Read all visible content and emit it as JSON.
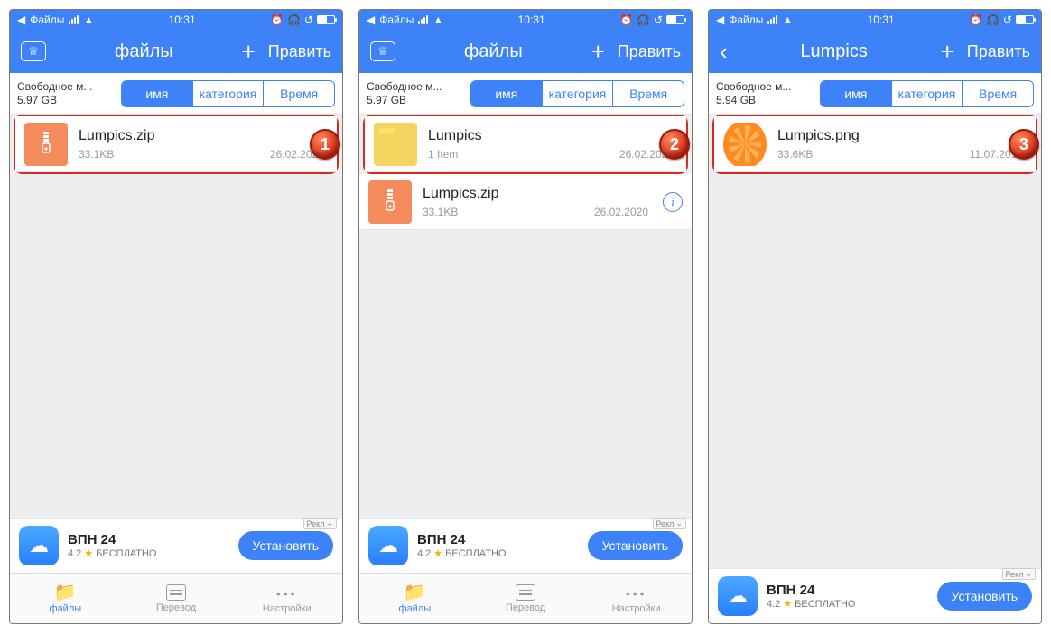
{
  "common": {
    "status_back": "Файлы",
    "status_time": "10:31",
    "edit": "Править",
    "sort": {
      "name": "имя",
      "category": "категория",
      "time": "Время"
    },
    "free_label": "Свободное м...",
    "ad": {
      "title": "ВПН 24",
      "rating": "4.2",
      "price": "БЕСПЛАТНО",
      "cta": "Установить",
      "tag": "Рекл"
    },
    "tabs": {
      "files": "файлы",
      "transfer": "Перевод",
      "settings": "Настройки"
    }
  },
  "screens": [
    {
      "title": "файлы",
      "has_back": false,
      "has_crown": true,
      "storage": "5.97 GB",
      "badge": "1",
      "show_tabbar": true,
      "items": [
        {
          "kind": "zip",
          "name": "Lumpics.zip",
          "meta1": "33.1KB",
          "meta2": "26.02.2020",
          "highlight": true
        }
      ]
    },
    {
      "title": "файлы",
      "has_back": false,
      "has_crown": true,
      "storage": "5.97 GB",
      "badge": "2",
      "show_tabbar": true,
      "items": [
        {
          "kind": "folder",
          "name": "Lumpics",
          "meta1": "1 Item",
          "meta2": "26.02.2020",
          "highlight": true
        },
        {
          "kind": "zip",
          "name": "Lumpics.zip",
          "meta1": "33.1KB",
          "meta2": "26.02.2020",
          "highlight": false,
          "info": true
        }
      ]
    },
    {
      "title": "Lumpics",
      "has_back": true,
      "has_crown": false,
      "storage": "5.94 GB",
      "badge": "3",
      "show_tabbar": false,
      "items": [
        {
          "kind": "image",
          "name": "Lumpics.png",
          "meta1": "33.6KB",
          "meta2": "11.07.2018",
          "highlight": true
        }
      ]
    }
  ]
}
